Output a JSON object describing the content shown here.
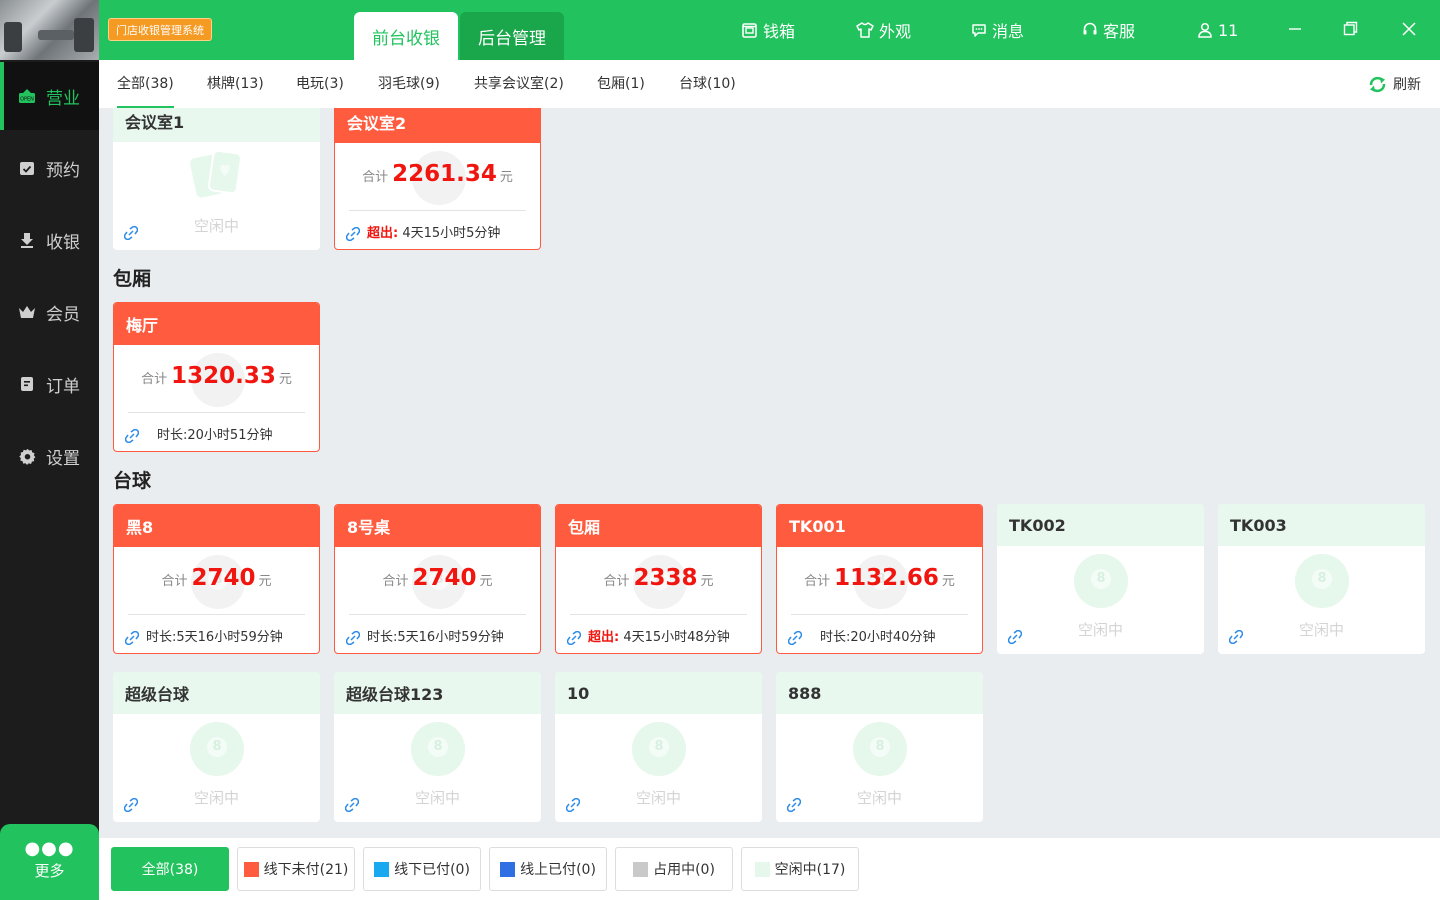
{
  "sidebar": {
    "items": [
      {
        "label": "营业",
        "icon": "open-sign-icon",
        "active": true
      },
      {
        "label": "预约",
        "icon": "calendar-check-icon"
      },
      {
        "label": "收银",
        "icon": "cash-download-icon"
      },
      {
        "label": "会员",
        "icon": "crown-icon"
      },
      {
        "label": "订单",
        "icon": "order-doc-icon"
      },
      {
        "label": "设置",
        "icon": "gear-icon"
      }
    ],
    "more_label": "更多"
  },
  "topbar": {
    "store_badge": "门店收银管理系统",
    "tabs": [
      {
        "label": "前台收银",
        "active": true
      },
      {
        "label": "后台管理"
      }
    ],
    "actions": [
      {
        "label": "钱箱",
        "icon": "cashbox-icon"
      },
      {
        "label": "外观",
        "icon": "shirt-icon"
      },
      {
        "label": "消息",
        "icon": "message-icon"
      },
      {
        "label": "客服",
        "icon": "headset-icon"
      },
      {
        "label": "11",
        "icon": "user-icon"
      }
    ]
  },
  "filters": {
    "tabs": [
      "全部(38)",
      "棋牌(13)",
      "电玩(3)",
      "羽毛球(9)",
      "共享会议室(2)",
      "包厢(1)",
      "台球(10)"
    ],
    "active_index": 0,
    "refresh_label": "刷新"
  },
  "common": {
    "total_label": "合计",
    "unit": "元",
    "idle_text": "空闲中"
  },
  "sections": [
    {
      "title": "",
      "cards": [
        {
          "name": "会议室1",
          "status": "idle",
          "icon": "cards-icon"
        },
        {
          "name": "会议室2",
          "status": "busy",
          "total": "2261.34",
          "time_prefix": "超出:",
          "time": "4天15小时5分钟",
          "overtime": true
        }
      ]
    },
    {
      "title": "包厢",
      "cards": [
        {
          "name": "梅厅",
          "status": "busy",
          "total": "1320.33",
          "time": "时长:20小时51分钟",
          "overtime": false
        }
      ]
    },
    {
      "title": "台球",
      "cards": [
        {
          "name": "黑8",
          "status": "busy",
          "total": "2740",
          "time": "时长:5天16小时59分钟"
        },
        {
          "name": "8号桌",
          "status": "busy",
          "total": "2740",
          "time": "时长:5天16小时59分钟"
        },
        {
          "name": "包厢",
          "status": "busy",
          "total": "2338",
          "time_prefix": "超出:",
          "time": "4天15小时48分钟",
          "overtime": true
        },
        {
          "name": "TK001",
          "status": "busy",
          "total": "1132.66",
          "time": "时长:20小时40分钟"
        },
        {
          "name": "TK002",
          "status": "idle"
        },
        {
          "name": "TK003",
          "status": "idle"
        },
        {
          "name": "超级台球",
          "status": "idle"
        },
        {
          "name": "超级台球123",
          "status": "idle"
        },
        {
          "name": "10",
          "status": "idle"
        },
        {
          "name": "888",
          "status": "idle"
        }
      ]
    }
  ],
  "legend": [
    {
      "label": "全部(38)",
      "color": "#22c35e",
      "all": true
    },
    {
      "label": "线下未付(21)",
      "color": "#ff5b3f"
    },
    {
      "label": "线下已付(0)",
      "color": "#1aa8f0"
    },
    {
      "label": "线上已付(0)",
      "color": "#2f6fe4"
    },
    {
      "label": "占用中(0)",
      "color": "#c9c9c9"
    },
    {
      "label": "空闲中(17)",
      "color": "#e6f7ec"
    }
  ]
}
